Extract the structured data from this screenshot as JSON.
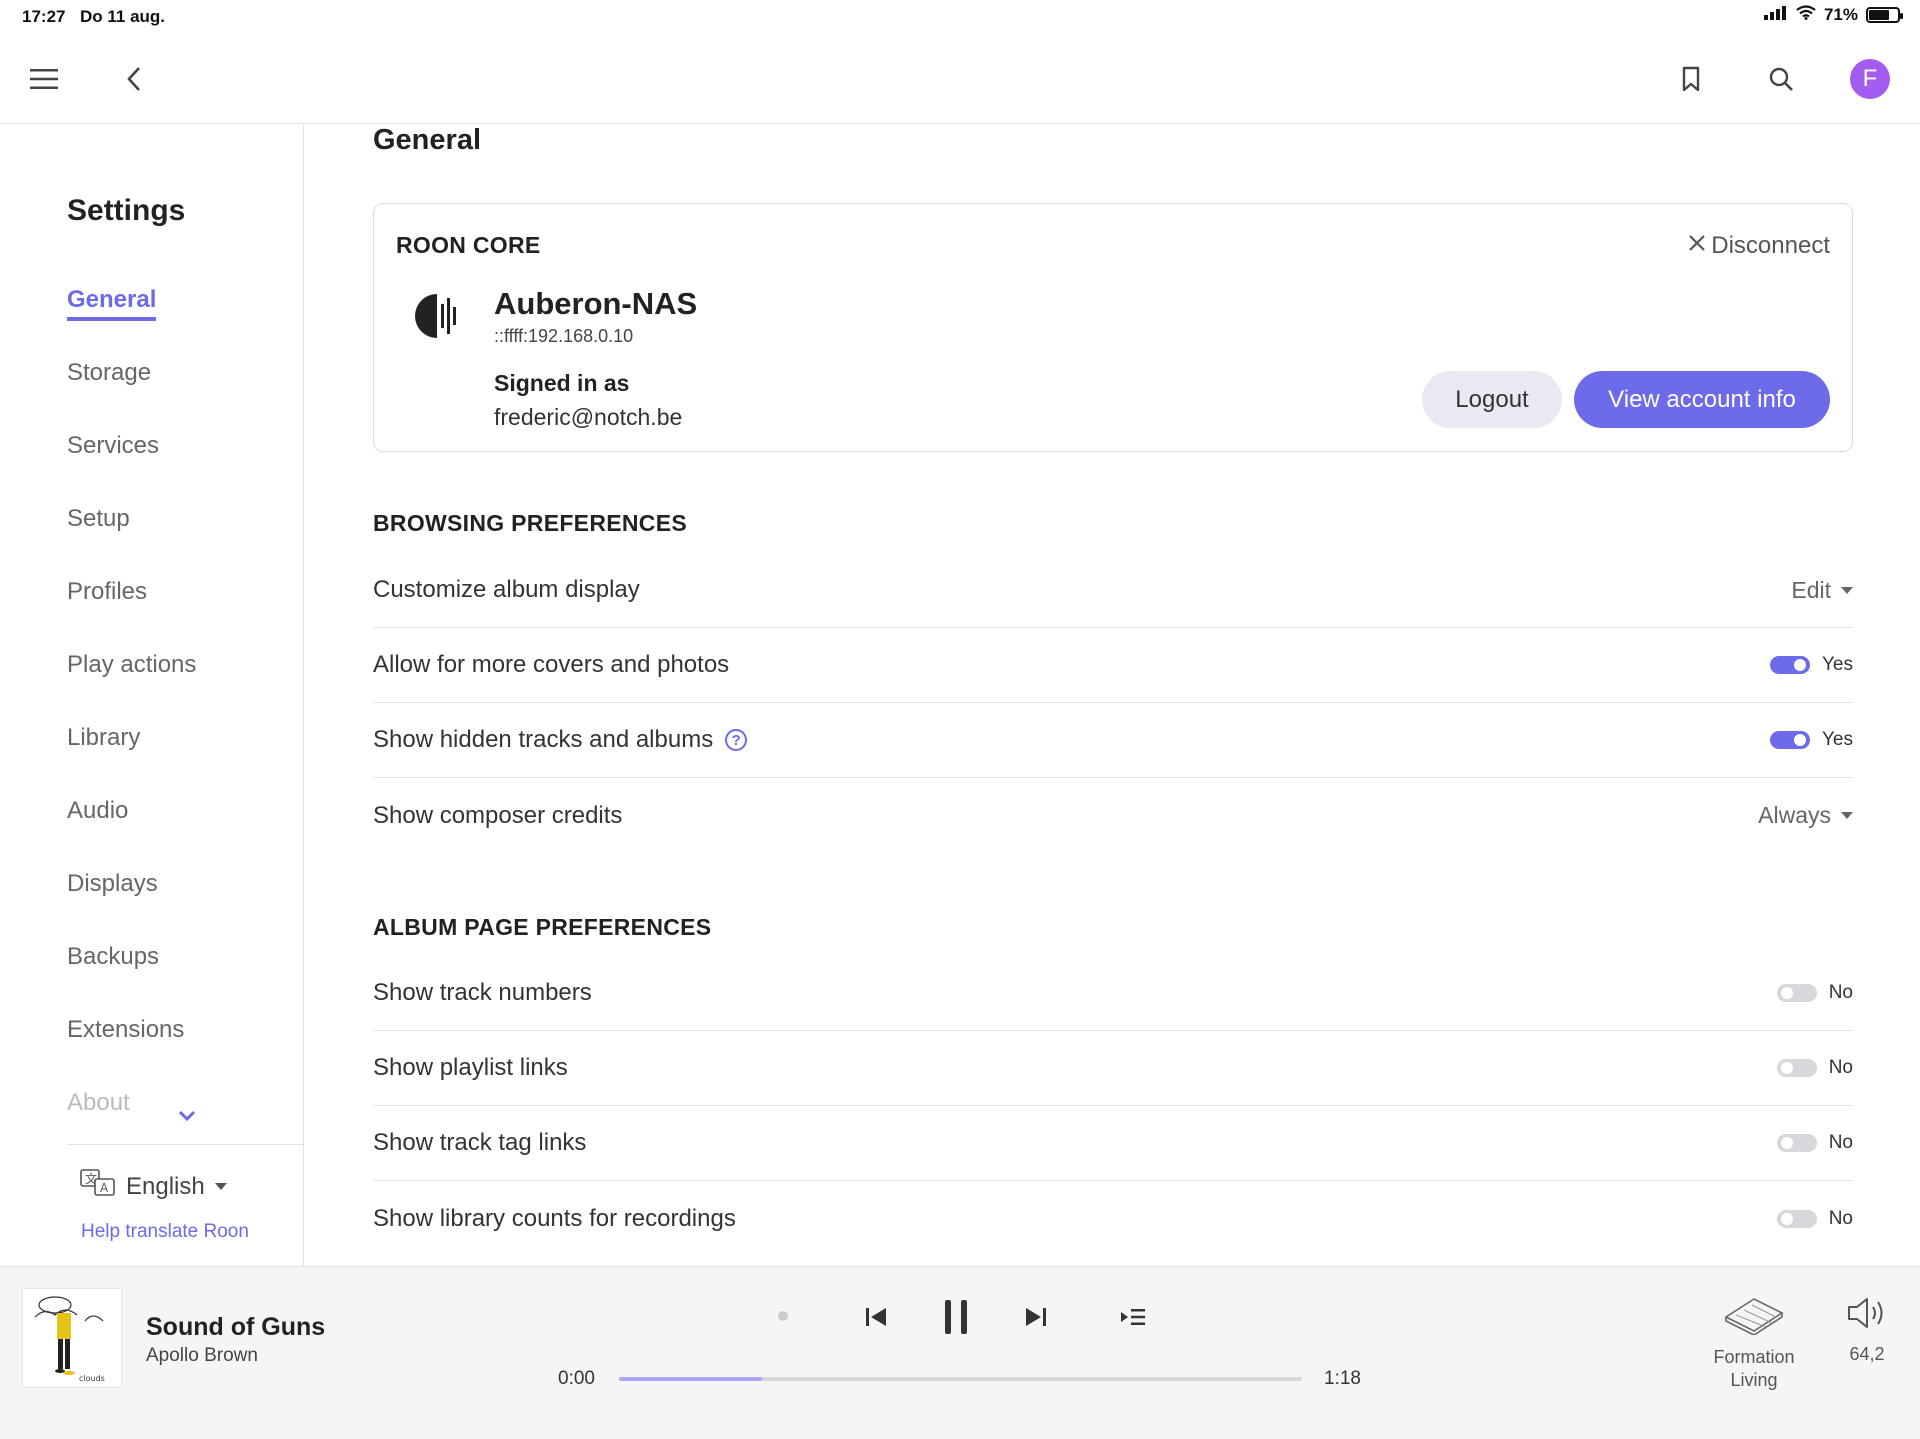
{
  "status": {
    "time": "17:27",
    "date": "Do 11 aug.",
    "battery": "71%",
    "battery_level": 0.71
  },
  "header": {
    "avatar_initial": "F"
  },
  "sidebar": {
    "title": "Settings",
    "items": [
      {
        "label": "General"
      },
      {
        "label": "Storage"
      },
      {
        "label": "Services"
      },
      {
        "label": "Setup"
      },
      {
        "label": "Profiles"
      },
      {
        "label": "Play actions"
      },
      {
        "label": "Library"
      },
      {
        "label": "Audio"
      },
      {
        "label": "Displays"
      },
      {
        "label": "Backups"
      },
      {
        "label": "Extensions"
      },
      {
        "label": "About"
      }
    ],
    "active_index": 0,
    "language": "English",
    "help_link": "Help translate Roon"
  },
  "main": {
    "title": "General",
    "core": {
      "label": "ROON CORE",
      "disconnect": "Disconnect",
      "name": "Auberon-NAS",
      "ip": "::ffff:192.168.0.10",
      "signed_in_label": "Signed in as",
      "email": "frederic@notch.be",
      "logout": "Logout",
      "view_account": "View account info"
    },
    "browsing": {
      "title": "BROWSING PREFERENCES",
      "rows": [
        {
          "label": "Customize album display",
          "dropdown": "Edit"
        },
        {
          "label": "Allow for more covers and photos",
          "toggle": "Yes",
          "on": true
        },
        {
          "label": "Show hidden tracks and albums",
          "help": "?",
          "toggle": "Yes",
          "on": true
        },
        {
          "label": "Show composer credits",
          "dropdown": "Always"
        }
      ]
    },
    "album": {
      "title": "ALBUM PAGE PREFERENCES",
      "rows": [
        {
          "label": "Show track numbers",
          "toggle": "No",
          "on": false
        },
        {
          "label": "Show playlist links",
          "toggle": "No",
          "on": false
        },
        {
          "label": "Show track tag links",
          "toggle": "No",
          "on": false
        },
        {
          "label": "Show library counts for recordings",
          "toggle": "No",
          "on": false
        }
      ]
    }
  },
  "player": {
    "track": "Sound of Guns",
    "artist": "Apollo Brown",
    "cover_text": "clouds",
    "elapsed": "0:00",
    "duration": "1:18",
    "progress": 0.21,
    "zone_line1": "Formation",
    "zone_line2": "Living",
    "volume": "64,2"
  },
  "colors": {
    "accent": "#6d6bea",
    "avatar": "#a35cf0",
    "toggle_off": "#d8d8dc"
  }
}
